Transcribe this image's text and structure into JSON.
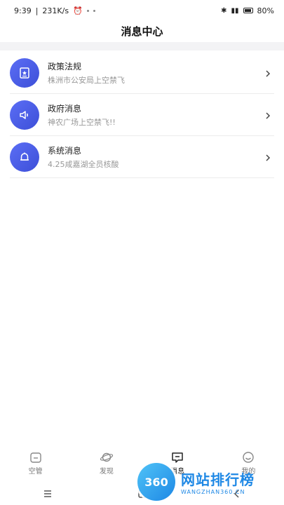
{
  "status_bar": {
    "time": "9:39",
    "speed": "231K/s",
    "battery": "80%"
  },
  "header": {
    "title": "消息中心"
  },
  "messages": [
    {
      "title": "政策法规",
      "subtitle": "株洲市公安局上空禁飞",
      "icon": "document-icon"
    },
    {
      "title": "政府消息",
      "subtitle": "神农广场上空禁飞!!",
      "icon": "speaker-icon"
    },
    {
      "title": "系统消息",
      "subtitle": "4.25咸嘉湖全员核酸",
      "icon": "bell-icon"
    }
  ],
  "tabbar": {
    "tabs": [
      {
        "label": "空管",
        "icon": "home-icon"
      },
      {
        "label": "发现",
        "icon": "planet-icon"
      },
      {
        "label": "消息",
        "icon": "chat-icon"
      },
      {
        "label": "我的",
        "icon": "smile-icon"
      }
    ],
    "active": "消息"
  },
  "watermark": {
    "badge": "360",
    "main": "网站排行榜",
    "sub": "WANGZHAN360.CN"
  },
  "colors": {
    "accent": "#4a5ce6",
    "subtitle": "#999999",
    "band": "#f3f3f5"
  }
}
